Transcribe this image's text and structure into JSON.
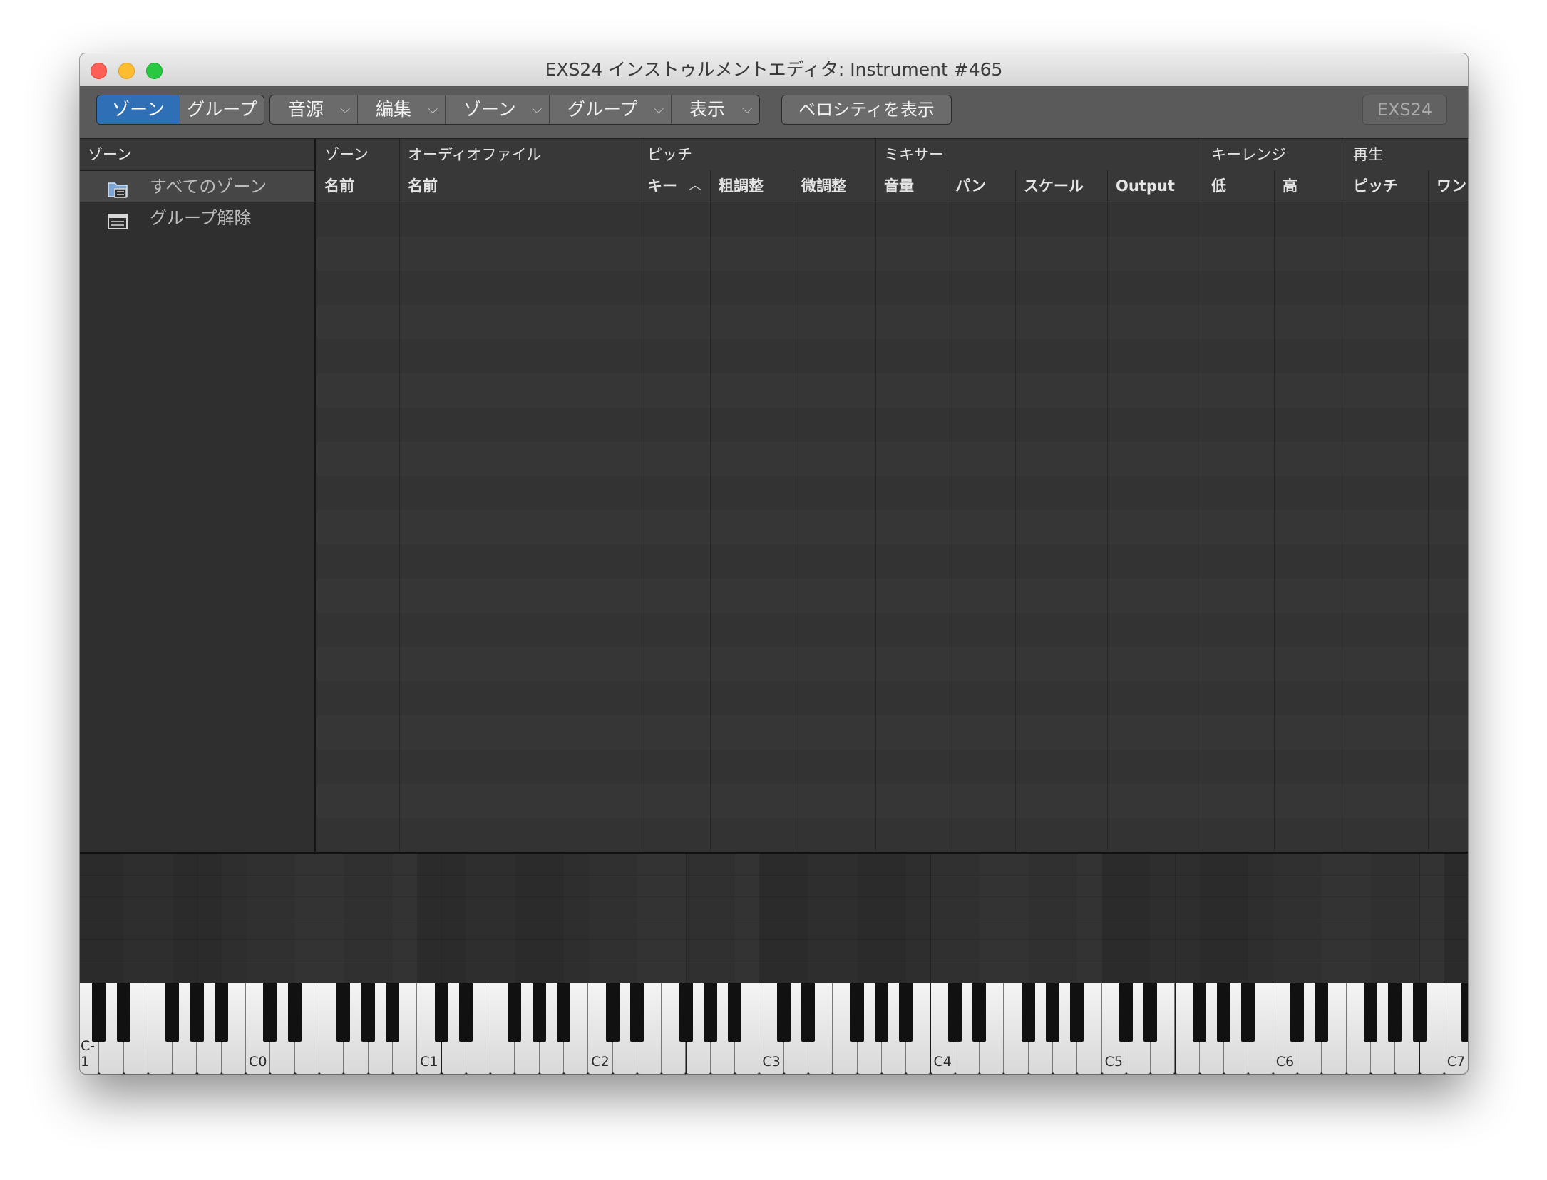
{
  "window": {
    "title": "EXS24 インストゥルメントエディタ: Instrument #465"
  },
  "toolbar": {
    "view_toggle": [
      "ゾーン",
      "グループ"
    ],
    "menus": [
      "音源",
      "編集",
      "ゾーン",
      "グループ",
      "表示"
    ],
    "velocity_button": "ベロシティを表示",
    "exs24_button": "EXS24"
  },
  "sidebar": {
    "header": "ゾーン",
    "items": [
      {
        "label": "すべてのゾーン",
        "icon": "folder-list-icon",
        "selected": true
      },
      {
        "label": "グループ解除",
        "icon": "list-icon",
        "selected": false
      }
    ]
  },
  "table": {
    "groups": [
      {
        "label": "ゾーン"
      },
      {
        "label": "オーディオファイル"
      },
      {
        "label": "ピッチ"
      },
      {
        "label": "ミキサー"
      },
      {
        "label": "キーレンジ"
      },
      {
        "label": "再生"
      }
    ],
    "columns": [
      {
        "label": "名前"
      },
      {
        "label": "名前"
      },
      {
        "label": "キー",
        "sort": "ascending"
      },
      {
        "label": "粗調整"
      },
      {
        "label": "微調整"
      },
      {
        "label": "音量"
      },
      {
        "label": "パン"
      },
      {
        "label": "スケール"
      },
      {
        "label": "Output"
      },
      {
        "label": "低"
      },
      {
        "label": "高"
      },
      {
        "label": "ピッチ"
      },
      {
        "label": "ワン"
      }
    ],
    "rows": []
  },
  "keyboard": {
    "labels": [
      "C-1",
      "C0",
      "C1",
      "C2",
      "C3",
      "C4",
      "C5",
      "C6",
      "C7"
    ]
  },
  "colors": {
    "accent": "#2e6fb5"
  }
}
